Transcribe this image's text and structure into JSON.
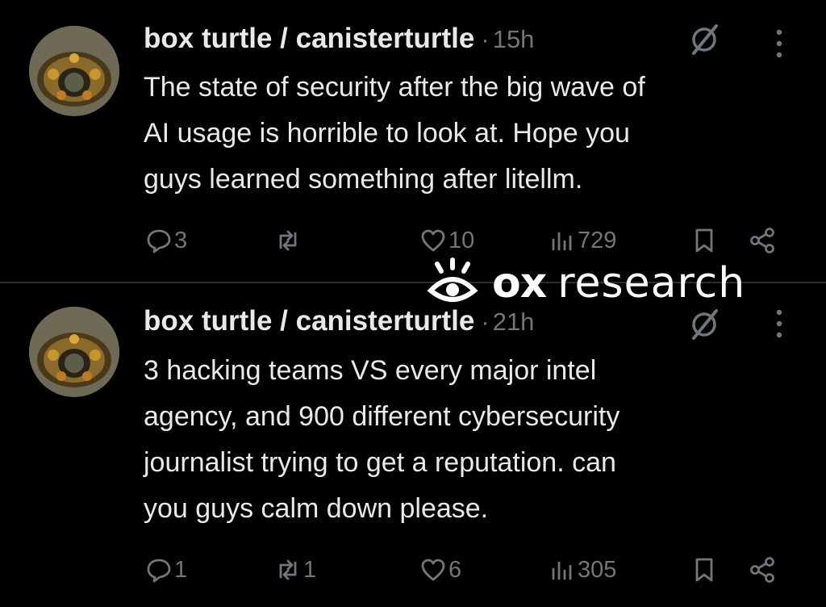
{
  "tweets": [
    {
      "display_name": "box turtle / canisterturtle",
      "separator": "·",
      "time": "15h",
      "text": "The state of security after the big wave of\nAI usage is horrible to look at. Hope you\nguys learned something after litellm.",
      "replies": "3",
      "retweets": "",
      "likes": "10",
      "views": "729"
    },
    {
      "display_name": "box turtle / canisterturtle",
      "separator": "·",
      "time": "21h",
      "text": "3 hacking teams VS every major intel\nagency, and 900 different cybersecurity\njournalist trying to get a reputation. can\nyou guys calm down please.",
      "replies": "1",
      "retweets": "1",
      "likes": "6",
      "views": "305"
    }
  ],
  "watermark": {
    "brand": "ox",
    "label": "research"
  },
  "icons": [
    "avatar-turtle",
    "badge-icon",
    "more-icon",
    "reply-icon",
    "retweet-icon",
    "like-icon",
    "views-icon",
    "bookmark-icon",
    "share-icon",
    "eye-logo-icon"
  ],
  "colors": {
    "background": "#000000",
    "text": "#e7e9ea",
    "muted": "#71767b",
    "divider": "#2a2d31"
  }
}
